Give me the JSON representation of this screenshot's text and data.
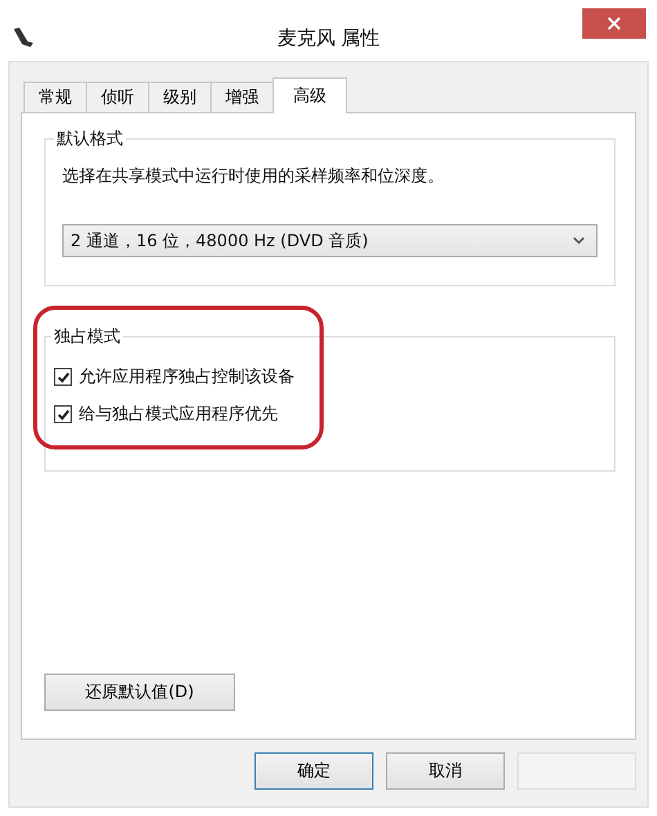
{
  "window": {
    "title": "麦克风 属性"
  },
  "tabs": [
    {
      "label": "常规",
      "selected": false
    },
    {
      "label": "侦听",
      "selected": false
    },
    {
      "label": "级别",
      "selected": false
    },
    {
      "label": "增强",
      "selected": false
    },
    {
      "label": "高级",
      "selected": true
    }
  ],
  "default_format": {
    "title": "默认格式",
    "description": "选择在共享模式中运行时使用的采样频率和位深度。",
    "dropdown_value": "2 通道，16 位，48000 Hz (DVD 音质)"
  },
  "exclusive_mode": {
    "title": "独占模式",
    "options": [
      {
        "label": "允许应用程序独占控制该设备",
        "checked": true
      },
      {
        "label": "给与独占模式应用程序优先",
        "checked": true
      }
    ]
  },
  "restore_button": "还原默认值(D)",
  "buttons": [
    {
      "label": "确定",
      "kind": "default"
    },
    {
      "label": "取消",
      "kind": "normal"
    },
    {
      "kind": "blank"
    }
  ]
}
